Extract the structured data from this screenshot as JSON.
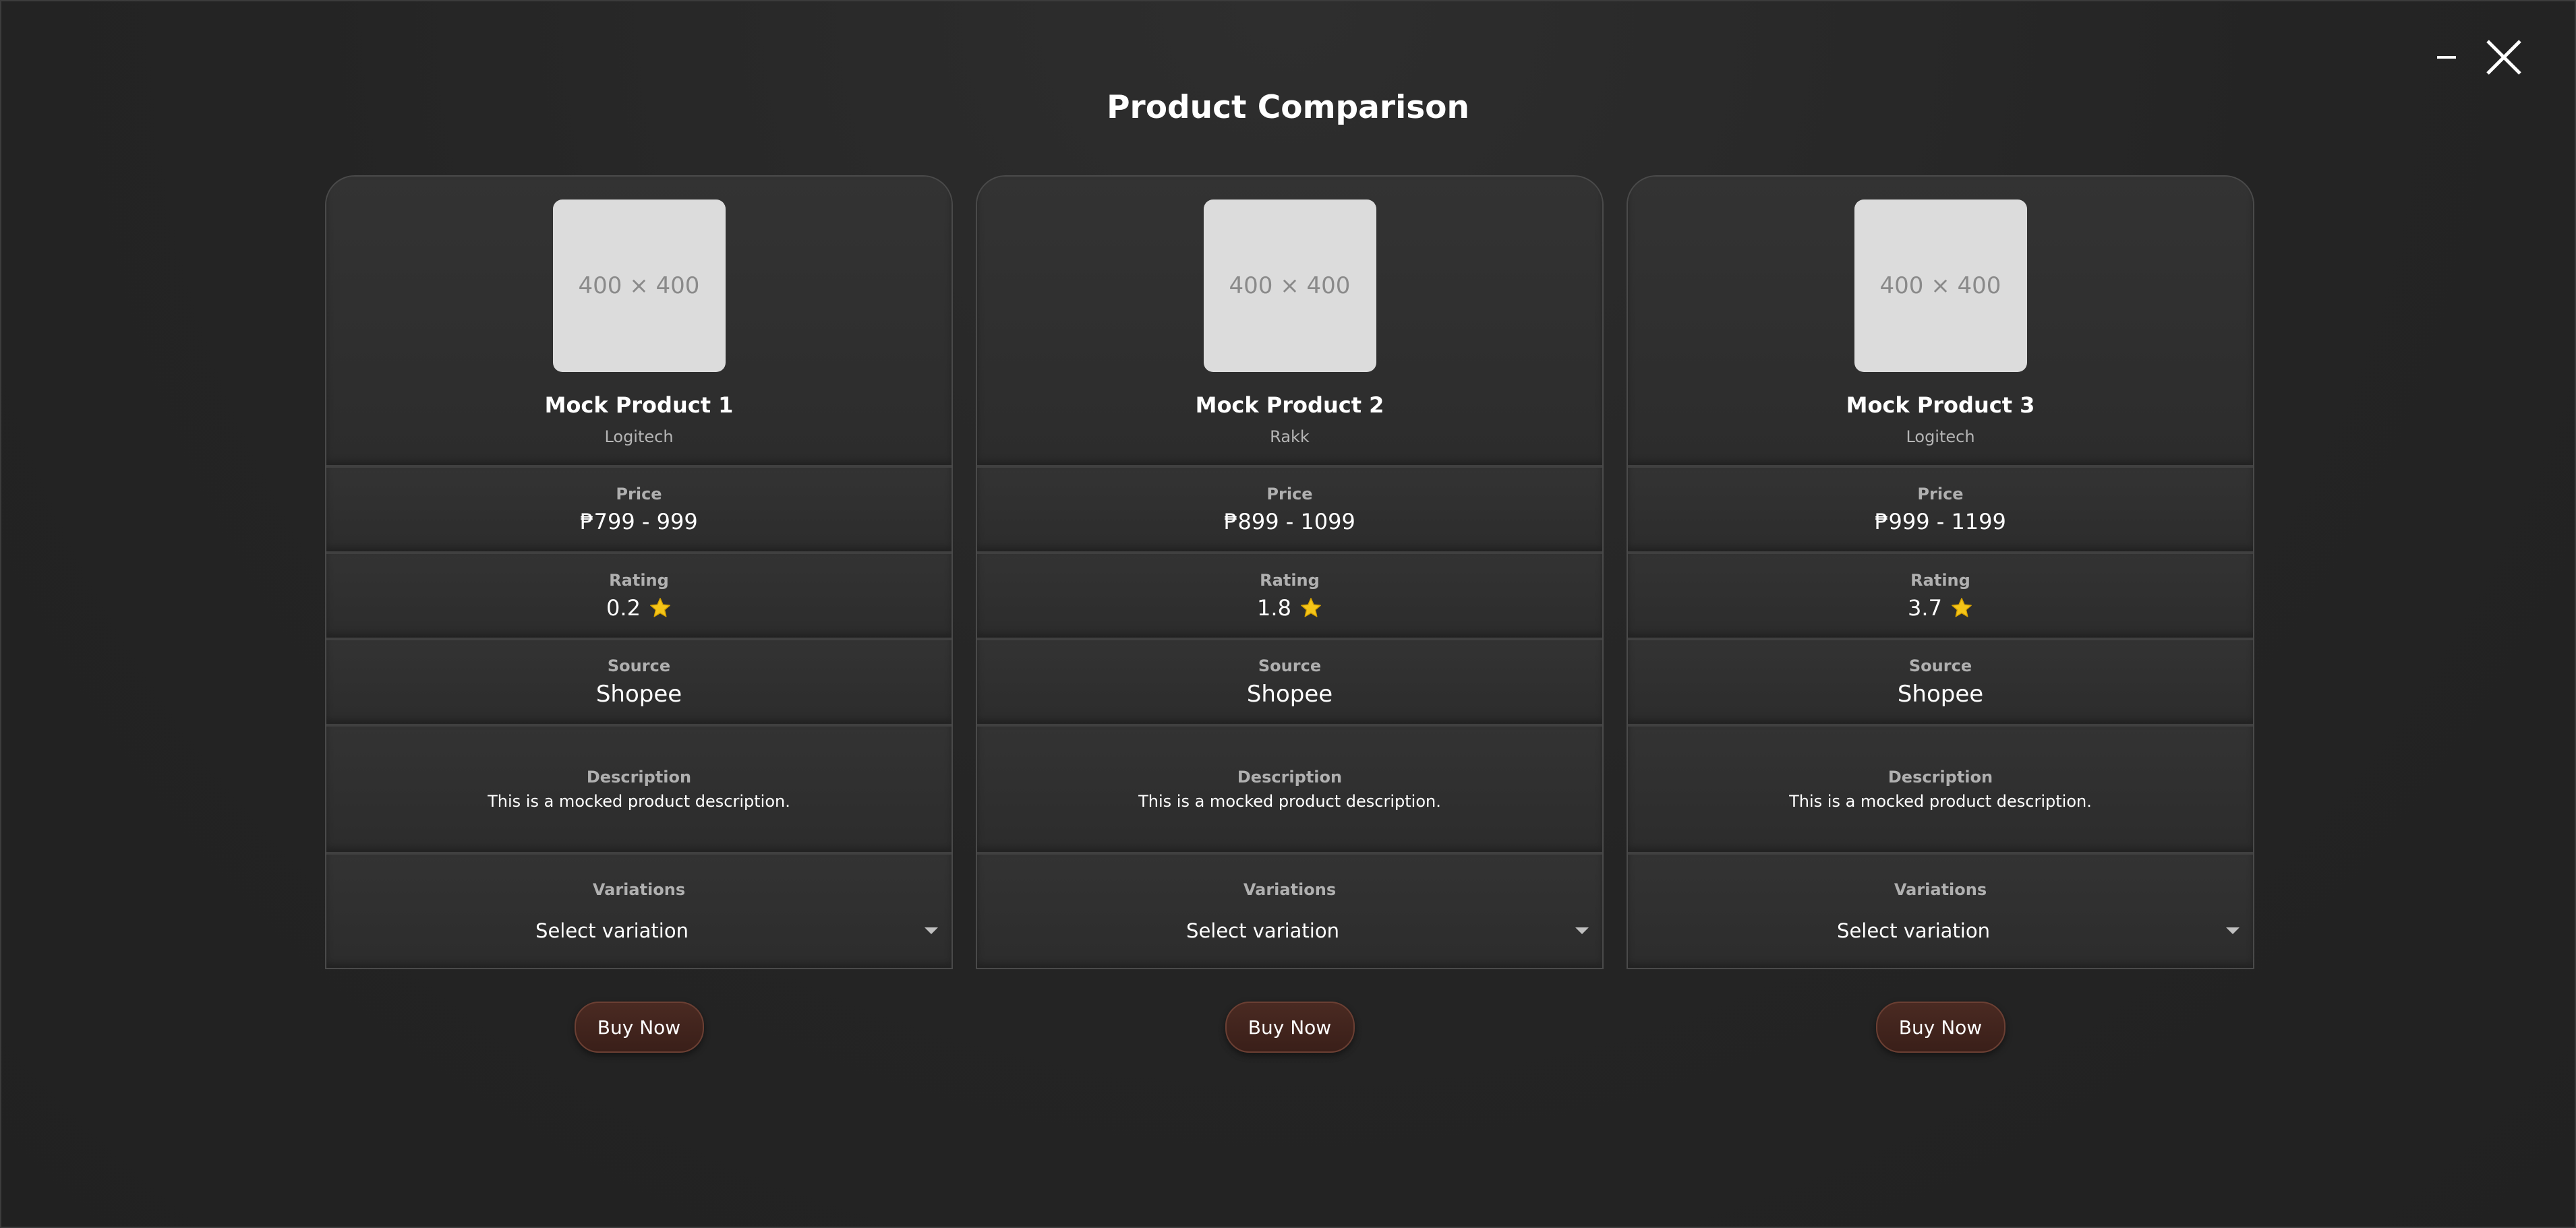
{
  "window": {
    "title": "Product Comparison"
  },
  "controls": {
    "minimize_icon": "minimize-icon",
    "close_icon": "close-icon"
  },
  "labels": {
    "price": "Price",
    "rating": "Rating",
    "source": "Source",
    "description": "Description",
    "variations": "Variations",
    "buy_now": "Buy Now",
    "select_placeholder": "Select variation"
  },
  "products": [
    {
      "image_label": "400 × 400",
      "name": "Mock Product 1",
      "brand": "Logitech",
      "price": "₱799 - 999",
      "rating": "0.2",
      "source": "Shopee",
      "description": "This is a mocked product description."
    },
    {
      "image_label": "400 × 400",
      "name": "Mock Product 2",
      "brand": "Rakk",
      "price": "₱899 - 1099",
      "rating": "1.8",
      "source": "Shopee",
      "description": "This is a mocked product description."
    },
    {
      "image_label": "400 × 400",
      "name": "Mock Product 3",
      "brand": "Logitech",
      "price": "₱999 - 1199",
      "rating": "3.7",
      "source": "Shopee",
      "description": "This is a mocked product description."
    }
  ],
  "colors": {
    "star": "#f5c518",
    "buy_button": "#3f231c",
    "background": "#242424"
  }
}
